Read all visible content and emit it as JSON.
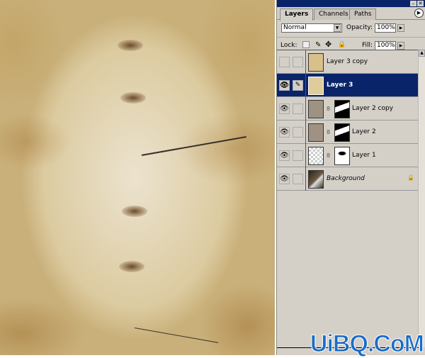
{
  "panel": {
    "tabs": [
      {
        "label": "Layers",
        "active": true
      },
      {
        "label": "Channels"
      },
      {
        "label": "Paths"
      }
    ],
    "blend_mode": "Normal",
    "opacity_label": "Opacity:",
    "opacity": "100%",
    "lock_label": "Lock:",
    "fill_label": "Fill:",
    "fill": "100%",
    "layers": [
      {
        "name": "Layer 3 copy",
        "visible": false,
        "selected": false
      },
      {
        "name": "Layer 3",
        "visible": true,
        "selected": true
      },
      {
        "name": "Layer 2 copy",
        "visible": true,
        "has_mask": true
      },
      {
        "name": "Layer 2",
        "visible": true,
        "has_mask": true
      },
      {
        "name": "Layer 1",
        "visible": true,
        "has_mask": true
      },
      {
        "name": "Background",
        "visible": true,
        "locked": true
      }
    ]
  },
  "watermark": "UiBQ.CoM",
  "colors": {
    "selection": "#0a246a",
    "panel": "#d4d0c8"
  }
}
